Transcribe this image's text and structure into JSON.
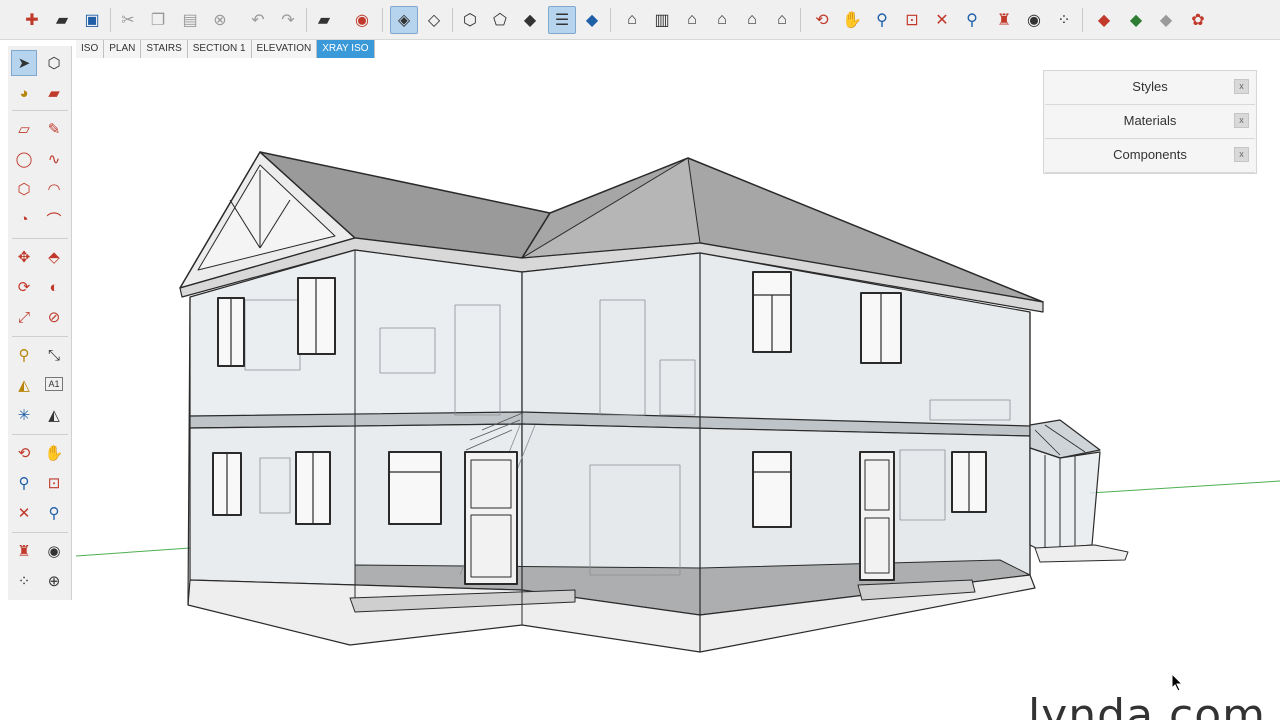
{
  "toolbar": {
    "buttons": [
      {
        "name": "new-model",
        "icon": "new-document-icon"
      },
      {
        "name": "open",
        "icon": "folder-open-icon"
      },
      {
        "name": "save",
        "icon": "floppy-disk-icon"
      },
      {
        "name": "cut",
        "icon": "scissors-icon"
      },
      {
        "name": "copy",
        "icon": "copy-icon"
      },
      {
        "name": "paste",
        "icon": "paste-icon"
      },
      {
        "name": "erase",
        "icon": "erase-icon"
      },
      {
        "name": "undo",
        "icon": "undo-icon"
      },
      {
        "name": "redo",
        "icon": "redo-icon"
      },
      {
        "name": "print",
        "icon": "printer-icon"
      },
      {
        "name": "model-info",
        "icon": "model-info-icon"
      },
      {
        "name": "xray",
        "icon": "xray-cube-icon",
        "active": true
      },
      {
        "name": "back-edges",
        "icon": "back-edges-cube-icon"
      },
      {
        "name": "wireframe",
        "icon": "wireframe-cube-icon"
      },
      {
        "name": "hidden-line",
        "icon": "hidden-line-cube-icon"
      },
      {
        "name": "shaded",
        "icon": "shaded-cube-icon"
      },
      {
        "name": "shaded-textures",
        "icon": "shaded-textures-cube-icon",
        "active": true
      },
      {
        "name": "monochrome",
        "icon": "monochrome-cube-icon"
      },
      {
        "name": "iso-view",
        "icon": "iso-house-icon"
      },
      {
        "name": "top-view",
        "icon": "top-house-icon"
      },
      {
        "name": "front-view",
        "icon": "front-house-icon"
      },
      {
        "name": "right-view",
        "icon": "right-house-icon"
      },
      {
        "name": "back-view",
        "icon": "back-house-icon"
      },
      {
        "name": "left-view",
        "icon": "left-house-icon"
      },
      {
        "name": "orbit",
        "icon": "orbit-icon"
      },
      {
        "name": "pan",
        "icon": "pan-hand-icon"
      },
      {
        "name": "zoom",
        "icon": "zoom-icon"
      },
      {
        "name": "zoom-window",
        "icon": "zoom-window-icon"
      },
      {
        "name": "zoom-extents",
        "icon": "zoom-extents-icon"
      },
      {
        "name": "previous",
        "icon": "previous-view-icon"
      },
      {
        "name": "position-camera",
        "icon": "position-camera-icon"
      },
      {
        "name": "look-around",
        "icon": "eye-icon"
      },
      {
        "name": "walk",
        "icon": "footprints-icon"
      },
      {
        "name": "warehouse",
        "icon": "3d-warehouse-icon"
      },
      {
        "name": "share-model",
        "icon": "share-model-icon"
      },
      {
        "name": "get-models",
        "icon": "get-models-icon"
      },
      {
        "name": "extension-warehouse",
        "icon": "extension-warehouse-icon"
      }
    ]
  },
  "left_tools": [
    {
      "name": "select",
      "icon": "arrow-cursor-icon",
      "active": true
    },
    {
      "name": "make-component",
      "icon": "make-component-icon"
    },
    {
      "name": "paint-bucket",
      "icon": "paint-bucket-icon"
    },
    {
      "name": "eraser",
      "icon": "eraser-icon"
    },
    {
      "name": "rectangle",
      "icon": "rectangle-icon"
    },
    {
      "name": "line",
      "icon": "pencil-icon"
    },
    {
      "name": "circle",
      "icon": "circle-icon"
    },
    {
      "name": "freehand",
      "icon": "freehand-icon"
    },
    {
      "name": "polygon",
      "icon": "polygon-icon"
    },
    {
      "name": "arc",
      "icon": "arc-icon"
    },
    {
      "name": "pie",
      "icon": "pie-icon"
    },
    {
      "name": "arc-3pt",
      "icon": "arc-3pt-icon"
    },
    {
      "name": "move",
      "icon": "move-icon"
    },
    {
      "name": "push-pull",
      "icon": "push-pull-icon"
    },
    {
      "name": "rotate",
      "icon": "rotate-icon"
    },
    {
      "name": "follow-me",
      "icon": "follow-me-icon"
    },
    {
      "name": "scale",
      "icon": "scale-icon"
    },
    {
      "name": "offset",
      "icon": "offset-icon"
    },
    {
      "name": "tape-measure",
      "icon": "tape-measure-icon"
    },
    {
      "name": "dimension",
      "icon": "dimension-icon"
    },
    {
      "name": "protractor",
      "icon": "protractor-icon"
    },
    {
      "name": "text",
      "icon": "text-tool-icon",
      "glyph": "A1"
    },
    {
      "name": "axes",
      "icon": "axes-icon"
    },
    {
      "name": "3d-text",
      "icon": "3d-text-icon"
    },
    {
      "name": "orbit",
      "icon": "orbit-icon"
    },
    {
      "name": "pan",
      "icon": "pan-hand-icon"
    },
    {
      "name": "zoom",
      "icon": "zoom-icon"
    },
    {
      "name": "zoom-window",
      "icon": "zoom-window-icon"
    },
    {
      "name": "zoom-extents",
      "icon": "zoom-extents-icon"
    },
    {
      "name": "previous",
      "icon": "previous-view-icon"
    },
    {
      "name": "position-camera",
      "icon": "position-camera-icon"
    },
    {
      "name": "look-around",
      "icon": "eye-icon"
    },
    {
      "name": "walk",
      "icon": "footprints-icon"
    },
    {
      "name": "section-plane",
      "icon": "section-plane-icon"
    }
  ],
  "scene_tabs": [
    {
      "label": "ISO",
      "active": false
    },
    {
      "label": "PLAN",
      "active": false
    },
    {
      "label": "STAIRS",
      "active": false
    },
    {
      "label": "SECTION 1",
      "active": false
    },
    {
      "label": "ELEVATION",
      "active": false
    },
    {
      "label": "XRAY ISO",
      "active": true
    }
  ],
  "tray": {
    "panels": [
      {
        "title": "Styles",
        "close": "x"
      },
      {
        "title": "Materials",
        "close": "x"
      },
      {
        "title": "Components",
        "close": "x"
      }
    ]
  },
  "watermark": {
    "text": "lynda.com"
  },
  "colors": {
    "accent": "#3a9ad9",
    "toolbar_bg": "#f0f0f0",
    "green_axis": "#4caf50",
    "model_line": "#2a2a2a",
    "xray_fill": "#d5dbe0"
  }
}
